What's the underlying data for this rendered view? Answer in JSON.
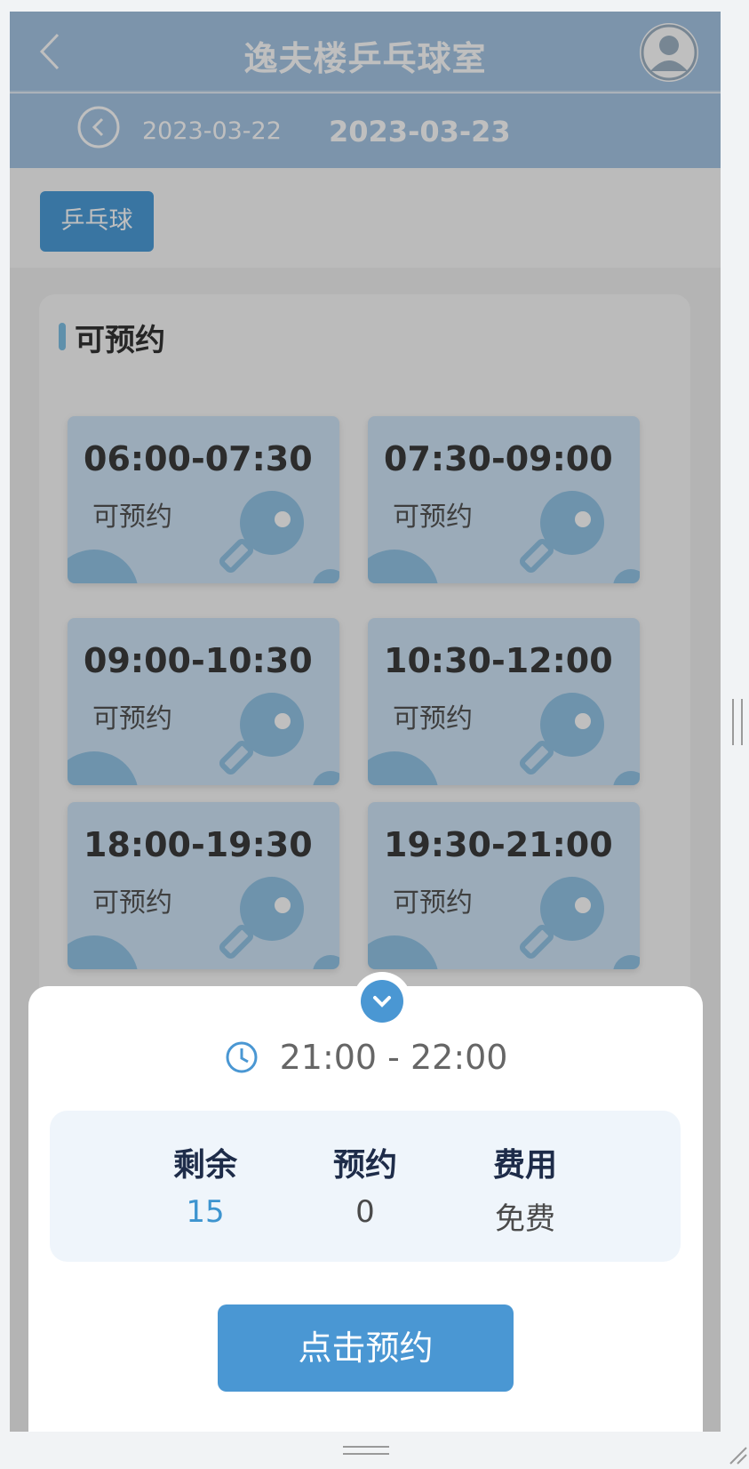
{
  "header": {
    "title": "逸夫楼乒乓球室"
  },
  "dates": {
    "previous": "2023-03-22",
    "current": "2023-03-23"
  },
  "category": {
    "label": "乒乓球"
  },
  "section": {
    "title": "可预约"
  },
  "slots": [
    {
      "time": "06:00-07:30",
      "status": "可预约"
    },
    {
      "time": "07:30-09:00",
      "status": "可预约"
    },
    {
      "time": "09:00-10:30",
      "status": "可预约"
    },
    {
      "time": "10:30-12:00",
      "status": "可预约"
    },
    {
      "time": "18:00-19:30",
      "status": "可预约"
    },
    {
      "time": "19:30-21:00",
      "status": "可预约"
    }
  ],
  "sheet": {
    "time_range": "21:00 - 22:00",
    "stats": {
      "remaining_label": "剩余",
      "remaining_value": "15",
      "booked_label": "预约",
      "booked_value": "0",
      "fee_label": "费用",
      "fee_value": "免费"
    },
    "book_button": "点击预约"
  },
  "colors": {
    "header_bg": "#a6c6e4",
    "accent": "#4a97d3",
    "slot_bg": "#cfe5f7"
  },
  "icons": [
    "back-icon",
    "avatar-icon",
    "chevron-left-circle-icon",
    "ping-pong-paddle-icon",
    "clock-icon",
    "chevron-down-icon"
  ]
}
